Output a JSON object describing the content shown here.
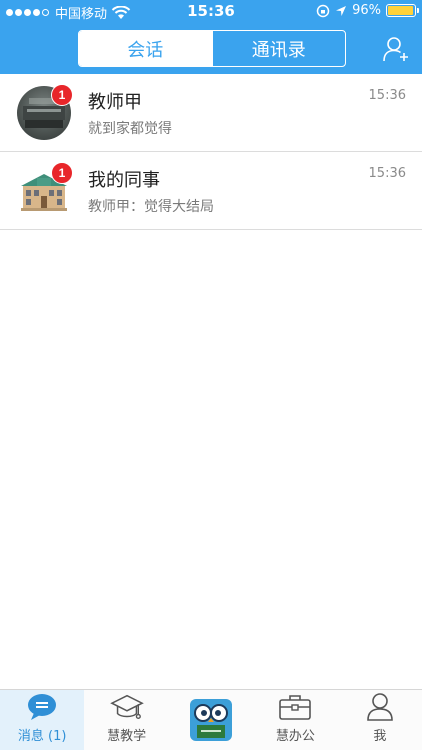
{
  "status_bar": {
    "carrier": "中国移动",
    "time": "15:36",
    "battery": "96%",
    "battery_level": 0.96
  },
  "nav": {
    "segments": [
      {
        "label": "会话",
        "active": true
      },
      {
        "label": "通讯录",
        "active": false
      }
    ],
    "add_contact_icon": "add-person-icon"
  },
  "conversations": [
    {
      "name": "教师甲",
      "preview": "就到家都觉得",
      "time": "15:36",
      "unread": "1",
      "avatar": "photo"
    },
    {
      "name": "我的同事",
      "preview": "教师甲：觉得大结局",
      "time": "15:36",
      "unread": "1",
      "avatar": "school-building"
    }
  ],
  "tabbar": {
    "tabs": [
      {
        "label": "消息 (1)",
        "icon": "message-icon",
        "active": true
      },
      {
        "label": "慧教学",
        "icon": "graduation-cap-icon",
        "active": false
      },
      {
        "label": "",
        "icon": "owl-logo-icon",
        "active": false
      },
      {
        "label": "慧办公",
        "icon": "briefcase-icon",
        "active": false
      },
      {
        "label": "我",
        "icon": "person-icon",
        "active": false
      }
    ]
  },
  "colors": {
    "brand_blue": "#3aa3ee",
    "badge_red": "#e8262a",
    "active_tab_bg": "#e3f1fb"
  }
}
